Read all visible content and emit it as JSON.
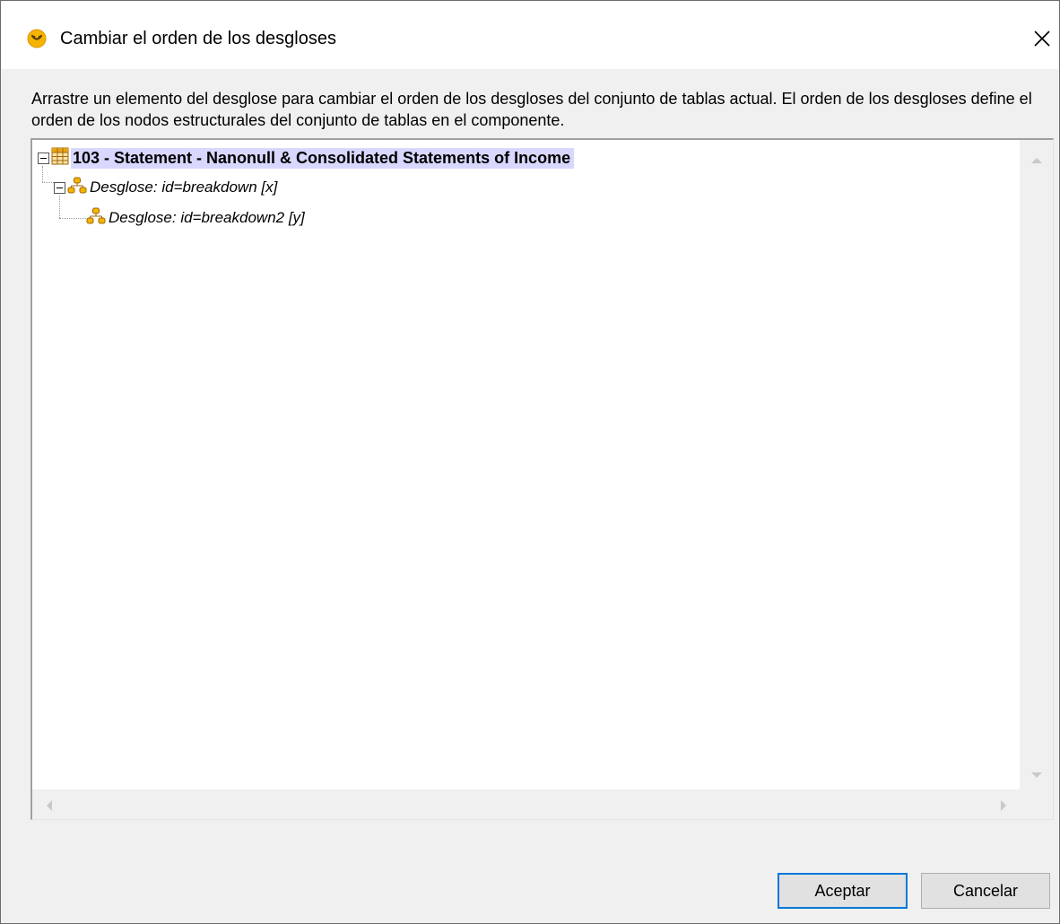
{
  "window": {
    "title": "Cambiar el orden de los desgloses",
    "app_icon": "altova-app-icon",
    "close_icon": "close-icon"
  },
  "description": "Arrastre un elemento del desglose para cambiar el orden de los desgloses del conjunto de tablas actual. El orden de los desgloses define el orden de los nodos estructurales del conjunto de tablas en el componente.",
  "tree": {
    "root": {
      "label": "103 - Statement - Nanonull & Consolidated Statements of Income",
      "icon": "table-icon",
      "expanded": true,
      "selected": true
    },
    "children": [
      {
        "label": "Desglose: id=breakdown [x]",
        "icon": "breakdown-icon",
        "expanded": true
      },
      {
        "label": "Desglose: id=breakdown2 [y]",
        "icon": "breakdown-icon"
      }
    ]
  },
  "buttons": {
    "ok_label": "Aceptar",
    "cancel_label": "Cancelar"
  },
  "colors": {
    "selection": "#d8d8ff",
    "icon_orange": "#e8a317",
    "default_button_border": "#0078d7"
  }
}
